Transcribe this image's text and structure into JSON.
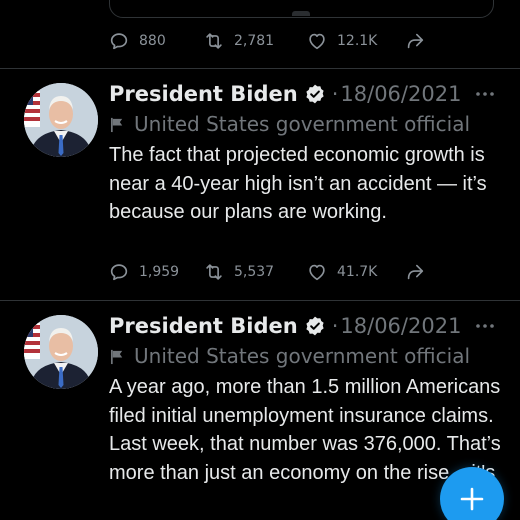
{
  "previous_tweet": {
    "stats": {
      "replies": "880",
      "retweets": "2,781",
      "likes": "12.1K"
    }
  },
  "tweets": [
    {
      "author": "President Biden",
      "separator": "·",
      "date": "18/06/2021",
      "label": "United States government official",
      "text": "The fact that projected economic growth is near a 40-year high isn’t an accident — it’s because our plans are working.",
      "stats": {
        "replies": "1,959",
        "retweets": "5,537",
        "likes": "41.7K"
      }
    },
    {
      "author": "President Biden",
      "separator": "·",
      "date": "18/06/2021",
      "label": "United States government official",
      "text": "A year ago, more than 1.5 million Americans filed initial unemployment insurance claims. Last week, that number was 376,000. That’s more than just an economy on the rise – it's"
    }
  ],
  "icons": {
    "reply": "reply-icon",
    "retweet": "retweet-icon",
    "like": "heart-icon",
    "share": "share-icon",
    "verified": "verified-badge-icon",
    "label": "flag-icon",
    "more": "more-options-icon",
    "compose": "compose-plus-icon"
  },
  "colors": {
    "background": "#000000",
    "text": "#e7e9ea",
    "muted": "#71767b",
    "accent": "#1d9bf0",
    "divider": "#2f3336"
  }
}
